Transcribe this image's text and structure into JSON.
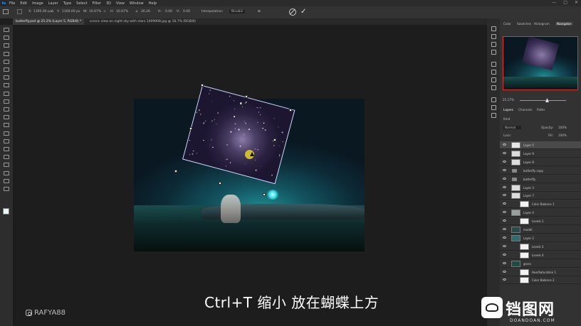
{
  "menu": {
    "items": [
      "File",
      "Edit",
      "Image",
      "Layer",
      "Type",
      "Select",
      "Filter",
      "3D",
      "View",
      "Window",
      "Help"
    ],
    "ps_logo": "Ps"
  },
  "options": {
    "x_value": "1395.00 px",
    "y_value": "1169.00 px",
    "w_value": "16.67%",
    "h_value": "16.67%",
    "angle_value": "26.26",
    "h_skew": "0.00",
    "v_skew": "0.00",
    "interpolation_label": "Interpolation:",
    "interpolation_value": "Bicubic"
  },
  "tabs": [
    {
      "label": "butterfly.psd @ 25.2% (Layer 5, RGB/8) *",
      "active": true
    },
    {
      "label": "scenic view on night sky with stars 1409908.jpg @ 16.7% (RGB/8)",
      "active": false
    }
  ],
  "panel": {
    "nav_tabs": [
      "Color",
      "Swatches",
      "Histogram",
      "Navigator"
    ],
    "zoom": "25.17%",
    "layer_tabs": [
      "Layers",
      "Channels",
      "Paths"
    ],
    "kind_label": "Kind",
    "blend_mode": "Normal",
    "opacity_label": "Opacity:",
    "opacity_value": "100%",
    "lock_label": "Lock:",
    "fill_label": "Fill:",
    "fill_value": "100%"
  },
  "layers": [
    {
      "name": "Layer 5",
      "selected": true,
      "kind": "pixel",
      "color": "#e6e6e6"
    },
    {
      "name": "Layer 9",
      "selected": false,
      "kind": "pixel",
      "color": "#dcdcdc"
    },
    {
      "name": "Layer 8",
      "selected": false,
      "kind": "pixel",
      "color": "#dcdcdc"
    },
    {
      "name": "butterfly copy",
      "selected": false,
      "kind": "group",
      "color": "#888888"
    },
    {
      "name": "butterfly",
      "selected": false,
      "kind": "group",
      "color": "#888888"
    },
    {
      "name": "Layer 3",
      "selected": false,
      "kind": "pixel",
      "color": "#dcdcdc"
    },
    {
      "name": "Layer 7",
      "selected": false,
      "kind": "pixel",
      "color": "#dcdcdc"
    },
    {
      "name": "Color Balance 1",
      "selected": false,
      "kind": "adjust",
      "color": "#f2f2f2"
    },
    {
      "name": "Layer 4",
      "selected": false,
      "kind": "pixel",
      "color": "#9aa0a0"
    },
    {
      "name": "Levels 1",
      "selected": false,
      "kind": "adjust",
      "color": "#f2f2f2"
    },
    {
      "name": "model",
      "selected": false,
      "kind": "pixel",
      "color": "#2b4b4b"
    },
    {
      "name": "Layer 2",
      "selected": false,
      "kind": "pixel",
      "color": "#2f6b70"
    },
    {
      "name": "Levels 3",
      "selected": false,
      "kind": "adjust",
      "color": "#f2f2f2"
    },
    {
      "name": "Levels 4",
      "selected": false,
      "kind": "adjust",
      "color": "#f2f2f2"
    },
    {
      "name": "grass",
      "selected": false,
      "kind": "pixel",
      "color": "#1f4a48"
    },
    {
      "name": "Hue/Saturation 1",
      "selected": false,
      "kind": "adjust",
      "color": "#f2f2f2"
    },
    {
      "name": "Color Balance 2",
      "selected": false,
      "kind": "adjust",
      "color": "#f2f2f2"
    }
  ],
  "subtitle": "Ctrl+T 缩小 放在蝴蝶上方",
  "watermark_left": "RAFYA88",
  "watermark_right": {
    "brand": "铛图网",
    "domain": "DOANDOAN.COM"
  },
  "icons": [
    "move-icon",
    "marquee-icon",
    "lasso-icon",
    "quick-select-icon",
    "crop-icon",
    "frame-icon",
    "eyedropper-icon",
    "healing-icon",
    "brush-icon",
    "stamp-icon",
    "history-brush-icon",
    "eraser-icon",
    "gradient-icon",
    "blur-icon",
    "dodge-icon",
    "pen-icon",
    "type-icon",
    "path-select-icon",
    "shape-icon",
    "hand-icon",
    "zoom-icon"
  ]
}
